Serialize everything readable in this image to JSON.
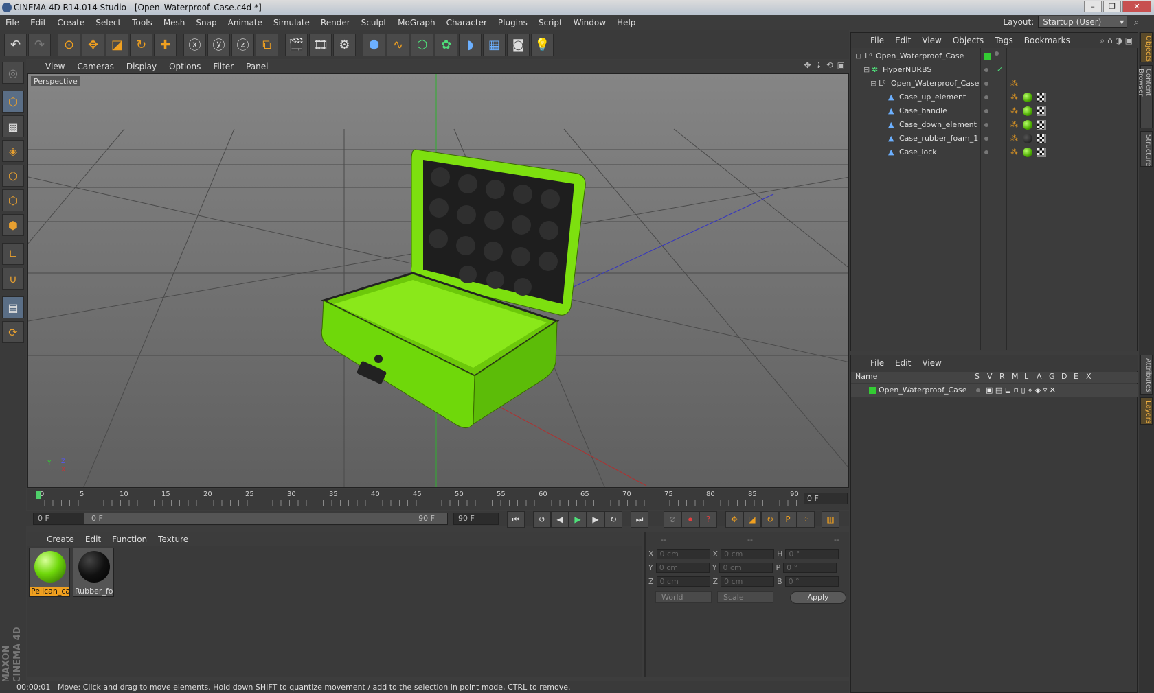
{
  "window": {
    "title": "CINEMA 4D R14.014 Studio - [Open_Waterproof_Case.c4d *]",
    "minimize": "–",
    "maximize": "❐",
    "close": "✕"
  },
  "menu": [
    "File",
    "Edit",
    "Create",
    "Select",
    "Tools",
    "Mesh",
    "Snap",
    "Animate",
    "Simulate",
    "Render",
    "Sculpt",
    "MoGraph",
    "Character",
    "Plugins",
    "Script",
    "Window",
    "Help"
  ],
  "layout": {
    "label": "Layout:",
    "value": "Startup (User)"
  },
  "viewport": {
    "menu": [
      "View",
      "Cameras",
      "Display",
      "Options",
      "Filter",
      "Panel"
    ],
    "label": "Perspective",
    "axis_y": "Y",
    "axis_x": "X",
    "axis_z": "Z",
    "model_color": "#7de00f"
  },
  "timeline": {
    "ticks": [
      "0",
      "5",
      "10",
      "15",
      "20",
      "25",
      "30",
      "35",
      "40",
      "45",
      "50",
      "55",
      "60",
      "65",
      "70",
      "75",
      "80",
      "85",
      "90"
    ],
    "current_frame": "0 F"
  },
  "playback": {
    "start": "0 F",
    "range_start": "0 F",
    "range_end": "90 F",
    "end": "90 F"
  },
  "materials": {
    "menu": [
      "Create",
      "Edit",
      "Function",
      "Texture"
    ],
    "items": [
      {
        "label": "Pelican_cas",
        "color": "#6fd80a"
      },
      {
        "label": "Rubber_foa",
        "color": "#111111"
      }
    ]
  },
  "coords": {
    "headers": [
      "--",
      "--",
      "--"
    ],
    "rows": [
      {
        "a": "X",
        "a_val": "0 cm",
        "b": "X",
        "b_val": "0 cm",
        "c": "H",
        "c_val": "0 °"
      },
      {
        "a": "Y",
        "a_val": "0 cm",
        "b": "Y",
        "b_val": "0 cm",
        "c": "P",
        "c_val": "0 °"
      },
      {
        "a": "Z",
        "a_val": "0 cm",
        "b": "Z",
        "b_val": "0 cm",
        "c": "B",
        "c_val": "0 °"
      }
    ],
    "mode1": "World",
    "mode2": "Scale",
    "apply": "Apply"
  },
  "status": {
    "time": "00:00:01",
    "message": "Move: Click and drag to move elements. Hold down SHIFT to quantize movement / add to the selection in point mode, CTRL to remove."
  },
  "objects": {
    "menu": [
      "File",
      "Edit",
      "View",
      "Objects",
      "Tags",
      "Bookmarks"
    ],
    "rows": [
      {
        "name": "Open_Waterproof_Case",
        "tags": "layer"
      },
      {
        "name": "HyperNURBS",
        "tags": "check"
      },
      {
        "name": "Open_Waterproof_Case",
        "tags": "none"
      },
      {
        "name": "Case_up_element",
        "tags": "green"
      },
      {
        "name": "Case_handle",
        "tags": "green"
      },
      {
        "name": "Case_down_element",
        "tags": "green"
      },
      {
        "name": "Case_rubber_foam_1",
        "tags": "black"
      },
      {
        "name": "Case_lock",
        "tags": "green"
      }
    ]
  },
  "layers": {
    "menu": [
      "File",
      "Edit",
      "View"
    ],
    "columns": [
      "Name",
      "S",
      "V",
      "R",
      "M",
      "L",
      "A",
      "G",
      "D",
      "E",
      "X"
    ],
    "rows": [
      {
        "name": "Open_Waterproof_Case",
        "color": "#33cc33"
      }
    ]
  },
  "right_tabs": [
    "Objects",
    "Content Browser",
    "Structure",
    "Attributes",
    "Layers"
  ],
  "brand": "MAXON CINEMA 4D"
}
